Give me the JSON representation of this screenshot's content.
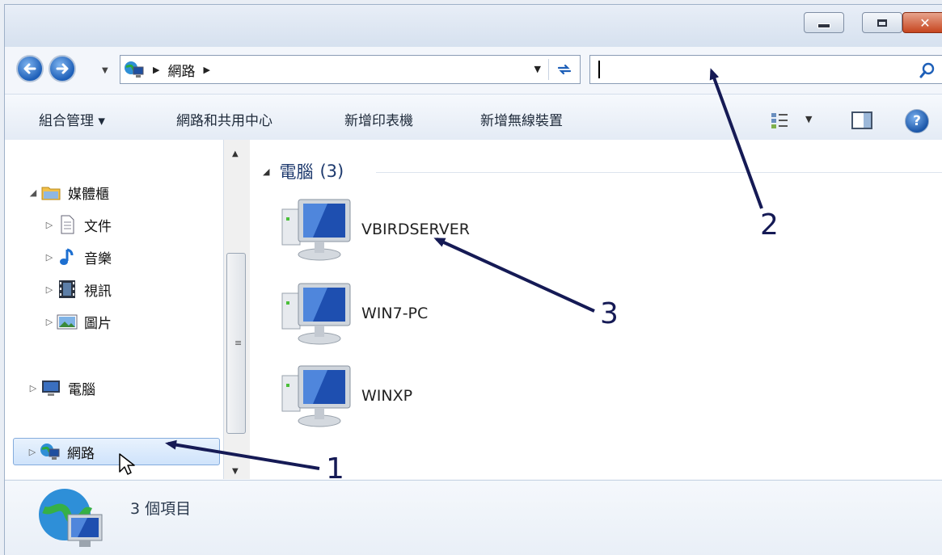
{
  "window": {
    "title_buttons": {
      "minimize": "minimize",
      "maximize": "maximize",
      "close": "✕"
    }
  },
  "address_bar": {
    "crumbs": [
      "網路"
    ],
    "network_icon": "network-icon",
    "refresh_icon": "refresh-icon"
  },
  "search": {
    "value": "",
    "icon": "search-icon"
  },
  "toolbar": {
    "organize": "組合管理 ▾",
    "network_center": "網路和共用中心",
    "add_printer": "新增印表機",
    "add_wireless": "新增無線裝置"
  },
  "nav_pane": {
    "libraries": "媒體櫃",
    "documents": "文件",
    "music": "音樂",
    "videos": "視訊",
    "pictures": "圖片",
    "computer": "電腦",
    "network": "網路"
  },
  "main": {
    "group_title": "電腦",
    "group_count": "(3)",
    "computers": [
      {
        "name": "VBIRDSERVER"
      },
      {
        "name": "WIN7-PC"
      },
      {
        "name": "WINXP"
      }
    ]
  },
  "details": {
    "count": "3 個項目"
  },
  "annotations": {
    "one": "1",
    "two": "2",
    "three": "3"
  },
  "colors": {
    "accent": "#1d5fb8",
    "annotation": "#151a55",
    "close": "#c6451f"
  }
}
